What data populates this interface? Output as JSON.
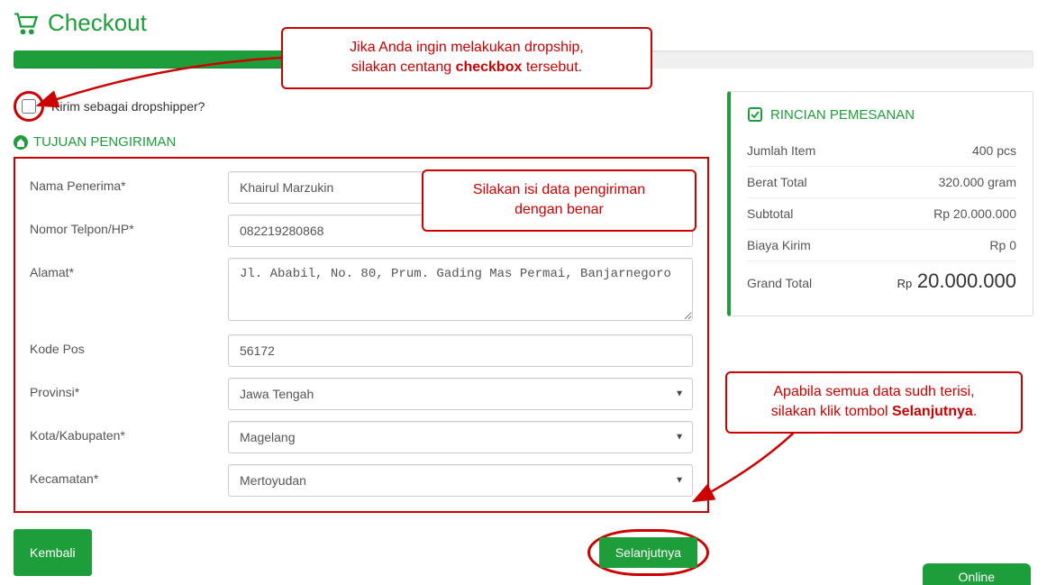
{
  "page": {
    "title": "Checkout",
    "progress_label": "50%"
  },
  "dropship": {
    "label": "Kirim sebagai dropshipper?"
  },
  "shipping_section": {
    "title": "TUJUAN PENGIRIMAN"
  },
  "form": {
    "nama_label": "Nama Penerima*",
    "nama_value": "Khairul Marzukin",
    "telp_label": "Nomor Telpon/HP*",
    "telp_value": "082219280868",
    "alamat_label": "Alamat*",
    "alamat_value": "Jl. Ababil, No. 80, Prum. Gading Mas Permai, Banjarnegoro",
    "kodepos_label": "Kode Pos",
    "kodepos_value": "56172",
    "provinsi_label": "Provinsi*",
    "provinsi_value": "Jawa Tengah",
    "kota_label": "Kota/Kabupaten*",
    "kota_value": "Magelang",
    "kecamatan_label": "Kecamatan*",
    "kecamatan_value": "Mertoyudan"
  },
  "buttons": {
    "back": "Kembali",
    "next": "Selanjutnya"
  },
  "order": {
    "title": "RINCIAN PEMESANAN",
    "jumlah_label": "Jumlah Item",
    "jumlah_value": "400 pcs",
    "berat_label": "Berat Total",
    "berat_value": "320.000 gram",
    "subtotal_label": "Subtotal",
    "subtotal_value": "Rp 20.000.000",
    "biaya_label": "Biaya Kirim",
    "biaya_value": "Rp 0",
    "grand_label": "Grand Total",
    "grand_prefix": "Rp ",
    "grand_value": "20.000.000"
  },
  "callouts": {
    "c1a": "Jika Anda ingin melakukan dropship,",
    "c1b_pre": "silakan centang ",
    "c1b_bold": "checkbox",
    "c1b_post": " tersebut.",
    "c2a": "Silakan isi data pengiriman",
    "c2b": "dengan benar",
    "c3a": "Apabila semua data sudh terisi,",
    "c3b_pre": "silakan klik tombol ",
    "c3b_bold": "Selanjutnya",
    "c3b_post": "."
  },
  "chat": {
    "label": "Online"
  }
}
